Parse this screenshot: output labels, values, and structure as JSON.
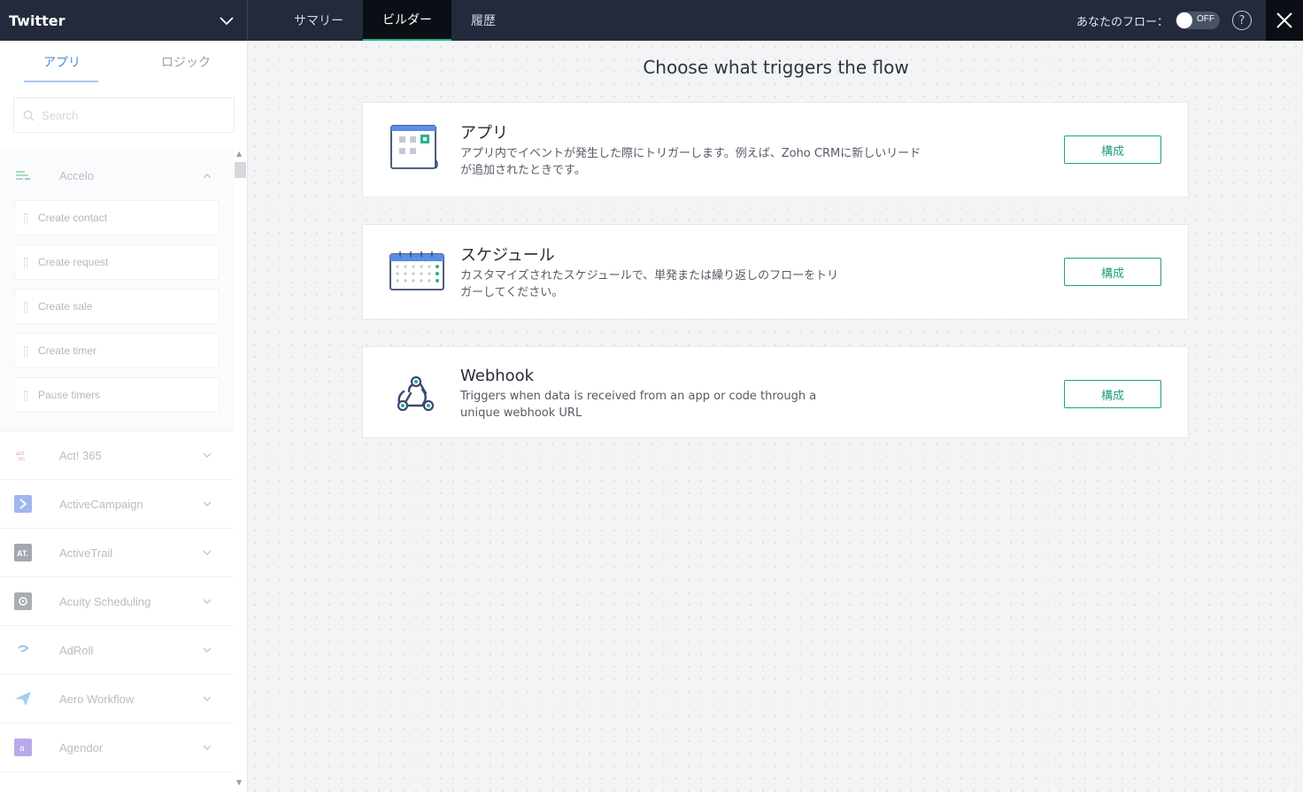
{
  "header": {
    "flow_name": "Twitter",
    "tabs": [
      {
        "label": "サマリー",
        "active": false
      },
      {
        "label": "ビルダー",
        "active": true
      },
      {
        "label": "履歴",
        "active": false
      }
    ],
    "flow_status_label": "あなたのフロー：",
    "toggle_text": "OFF",
    "help_text": "?",
    "accent_color": "#1fb590"
  },
  "sidebar": {
    "tabs": {
      "apps": "アプリ",
      "logic": "ロジック"
    },
    "search_placeholder": "Search",
    "expanded_app": {
      "name": "Accelo",
      "actions": [
        "Create contact",
        "Create request",
        "Create sale",
        "Create timer",
        "Pause timers"
      ]
    },
    "apps": [
      {
        "name": "Act! 365",
        "icon": "act365-icon"
      },
      {
        "name": "ActiveCampaign",
        "icon": "activecampaign-icon"
      },
      {
        "name": "ActiveTrail",
        "icon": "activetrail-icon"
      },
      {
        "name": "Acuity Scheduling",
        "icon": "acuity-icon"
      },
      {
        "name": "AdRoll",
        "icon": "adroll-icon"
      },
      {
        "name": "Aero Workflow",
        "icon": "aero-workflow-icon"
      },
      {
        "name": "Agendor",
        "icon": "agendor-icon"
      }
    ]
  },
  "main": {
    "title": "Choose what triggers the flow",
    "cards": [
      {
        "title": "アプリ",
        "desc_line1": "アプリ内でイベントが発生した際にトリガーします。例えば、Zoho CRMに新しいリード",
        "desc_line2": "が追加されたときです。",
        "button": "構成",
        "icon": "app-window-icon"
      },
      {
        "title": "スケジュール",
        "desc_line1": "カスタマイズされたスケジュールで、単発または繰り返しのフローをトリ",
        "desc_line2": "ガーしてください。",
        "button": "構成",
        "icon": "calendar-icon"
      },
      {
        "title": "Webhook",
        "desc_line1": "Triggers when data is received from an app or code through a",
        "desc_line2": "unique webhook URL",
        "button": "構成",
        "icon": "webhook-icon"
      }
    ]
  }
}
